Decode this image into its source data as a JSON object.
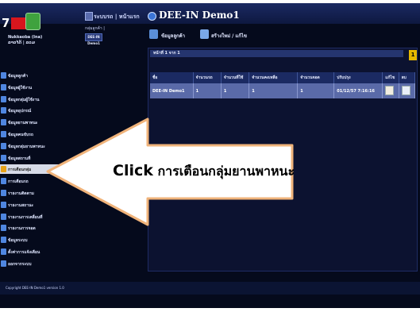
{
  "header": {
    "logo_number": "7",
    "user_lines": [
      "Nukkaoba (Ina)",
      "ລາວໄດ້ | ລວມ"
    ],
    "breadcrumb": "ระบบรถ | หน้าแรก",
    "app_title": "DEE-IN Demo1",
    "sub_label": "กลุ่มลูกค้า |",
    "sub_button": "DEE-IN Demo1"
  },
  "toolbar": {
    "items": [
      {
        "label": "ข้อมูลลูกค้า",
        "icon": "folder-icon",
        "color": "#5b8fd8"
      },
      {
        "label": "สร้างใหม่ / แก้ไข",
        "icon": "edit-icon",
        "color": "#7aa8e8"
      }
    ]
  },
  "panel": {
    "header_text": "หน้าที่ 1 จาก 1",
    "scroll_label": "1",
    "columns": [
      "ชื่อ",
      "จำนวนรถ",
      "จำนวนที่ใช้",
      "จำนวนคงเหลือ",
      "จำนวนจอด",
      "ปรับปรุง",
      "แก้ไข",
      "ลบ"
    ],
    "rows": [
      {
        "name": "DEE-IN Demo1",
        "c1": "1",
        "c2": "1",
        "c3": "1",
        "c4": "1",
        "updated": "01/12/57 7:16:16"
      }
    ]
  },
  "sidebar": {
    "items": [
      {
        "label": "ข้อมูลลูกค้า",
        "icon": "user-icon",
        "color": "#4f86e0"
      },
      {
        "label": "ข้อมูลผู้ใช้งาน",
        "icon": "users-icon",
        "color": "#4f86e0"
      },
      {
        "label": "ข้อมูลกลุ่มผู้ใช้งาน",
        "icon": "group-icon",
        "color": "#4f86e0"
      },
      {
        "label": "ข้อมูลอุปกรณ์",
        "icon": "device-icon",
        "color": "#4f86e0"
      },
      {
        "label": "ข้อมูลยานพาหนะ",
        "icon": "car-icon",
        "color": "#4f86e0"
      },
      {
        "label": "ข้อมูลคนขับรถ",
        "icon": "driver-icon",
        "color": "#4f86e0"
      },
      {
        "label": "ข้อมูลกลุ่มยานพาหนะ",
        "icon": "car-group-icon",
        "color": "#4f86e0"
      },
      {
        "label": "ข้อมูลสถานที่",
        "icon": "pin-icon",
        "color": "#4f86e0"
      },
      {
        "label": "การเตือนกลุ่ม",
        "icon": "bell-icon",
        "color": "#e6a21a"
      },
      {
        "label": "การเตือนรถ",
        "icon": "alarm-icon",
        "color": "#4f86e0"
      },
      {
        "label": "รายงานติดตาม",
        "icon": "report-icon",
        "color": "#4f86e0"
      },
      {
        "label": "รายงานสถานะ",
        "icon": "status-icon",
        "color": "#4f86e0"
      },
      {
        "label": "รายงานการเคลื่อนที่",
        "icon": "route-icon",
        "color": "#4f86e0"
      },
      {
        "label": "รายงานการจอด",
        "icon": "parking-icon",
        "color": "#4f86e0"
      },
      {
        "label": "ข้อมูลระบบ",
        "icon": "system-icon",
        "color": "#4f86e0"
      },
      {
        "label": "ตั้งค่าการแจ้งเตือน",
        "icon": "settings-icon",
        "color": "#4f86e0"
      },
      {
        "label": "ออกจากระบบ",
        "icon": "logout-icon",
        "color": "#4f86e0"
      }
    ],
    "selected_index": 8
  },
  "footer": {
    "text": "Copyright DEE-IN Demo1 version 1.0"
  },
  "callout": {
    "click_word": "Click",
    "rest": "การเตือนกลุ่มยานพาหนะ"
  }
}
